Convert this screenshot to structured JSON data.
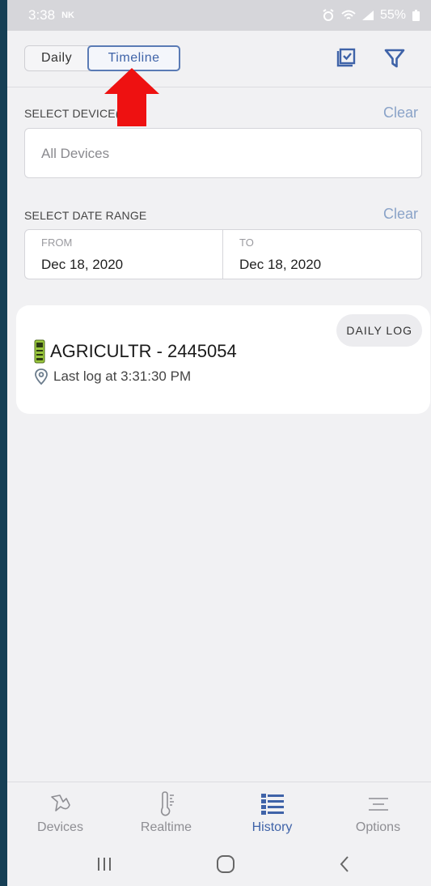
{
  "status_bar": {
    "time": "3:38",
    "carrier_tag": "NK",
    "battery": "55%"
  },
  "toolbar": {
    "segments": [
      {
        "label": "Daily"
      },
      {
        "label": "Timeline"
      }
    ],
    "active_segment": "Timeline",
    "icons": [
      "select-all-icon",
      "filter-icon"
    ]
  },
  "device_filter": {
    "label": "SELECT DEVICE(S)",
    "clear_label": "Clear",
    "placeholder": "All Devices"
  },
  "date_filter": {
    "label": "SELECT DATE RANGE",
    "clear_label": "Clear",
    "from_caption": "FROM",
    "from_value": "Dec 18, 2020",
    "to_caption": "TO",
    "to_value": "Dec 18, 2020"
  },
  "device_card": {
    "badge": "DAILY LOG",
    "device_name": "AGRICULTR - 2445054",
    "last_log": "Last log at 3:31:30 PM"
  },
  "tabs": [
    {
      "label": "Devices",
      "icon": "bird-icon"
    },
    {
      "label": "Realtime",
      "icon": "thermometer-icon"
    },
    {
      "label": "History",
      "icon": "list-icon"
    },
    {
      "label": "Options",
      "icon": "menu-icon"
    }
  ],
  "active_tab": "History",
  "colors": {
    "accent": "#3f63a8",
    "annotation_arrow": "#ee1111",
    "clear_link": "#8aa3c8"
  }
}
